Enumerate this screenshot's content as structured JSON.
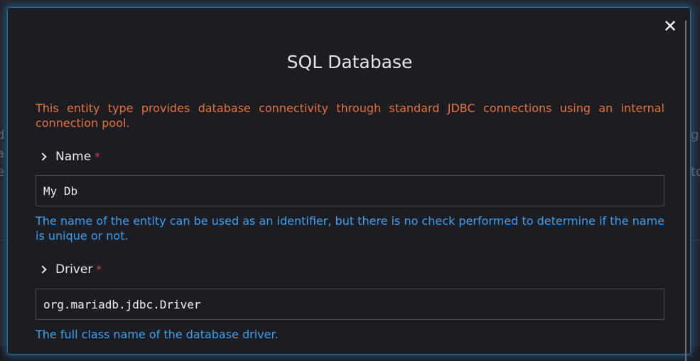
{
  "modal": {
    "title": "SQL Database",
    "intro": "This entity type provides database connectivity through standard JDBC connections using an internal connection pool.",
    "close_symbol": "✕"
  },
  "fields": [
    {
      "label": "Name",
      "required_marker": "*",
      "value": "My Db",
      "help": "The name of the entity can be used as an identifier, but there is no check performed to determine if the name is unique or not."
    },
    {
      "label": "Driver",
      "required_marker": "*",
      "value": "org.mariadb.jdbc.Driver",
      "help": "The full class name of the database driver."
    }
  ],
  "background": {
    "left_fragments": [
      "d",
      "a",
      "e"
    ],
    "right_fragments": [
      "g",
      "to"
    ]
  },
  "colors": {
    "intro_text": "#e8743b",
    "help_text": "#3ea0f0",
    "required": "#e03a4e",
    "modal_border_glow": "#2c6d9a"
  }
}
